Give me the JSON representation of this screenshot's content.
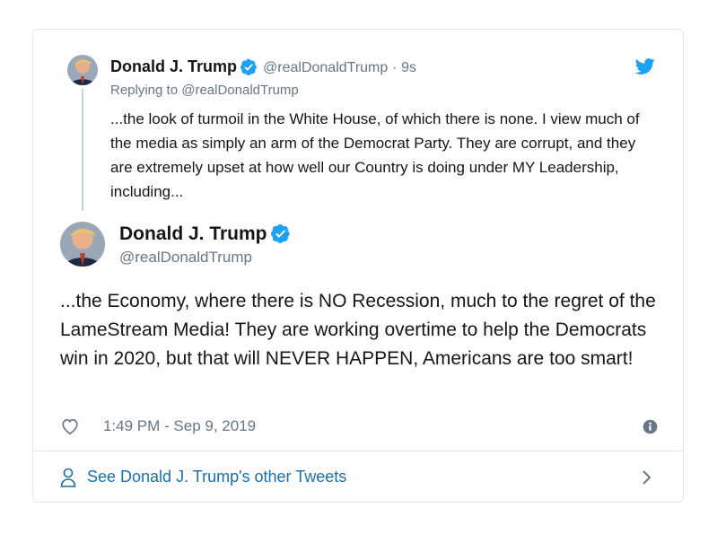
{
  "reply": {
    "author_name": "Donald J. Trump",
    "handle": "@realDonaldTrump",
    "separator": "·",
    "time": "9s",
    "replying_prefix": "Replying to",
    "replying_handle": "@realDonaldTrump",
    "text": "...the look of turmoil in the White House, of which there is none. I view much of the media as simply an arm of the Democrat Party. They are corrupt, and they are extremely upset at how well our Country is doing under MY Leadership, including..."
  },
  "tweet": {
    "author_name": "Donald J. Trump",
    "handle": "@realDonaldTrump",
    "text": "...the Economy, where there is NO Recession, much to the regret of the LameStream Media! They are working overtime to help the Democrats win in 2020, but that will NEVER HAPPEN, Americans are too smart!",
    "timestamp": "1:49 PM - Sep 9, 2019"
  },
  "footer": {
    "label": "See Donald J. Trump's other Tweets"
  },
  "icons": {
    "brand": "twitter-bird-icon",
    "verified": "verified-badge-icon",
    "like": "heart-icon",
    "info": "info-icon",
    "profile": "person-icon",
    "chevron": "chevron-right-icon"
  },
  "colors": {
    "twitter_blue": "#1da1f2",
    "link_blue": "#1b6fa8",
    "muted": "#657786",
    "border": "#e1e8ed"
  }
}
